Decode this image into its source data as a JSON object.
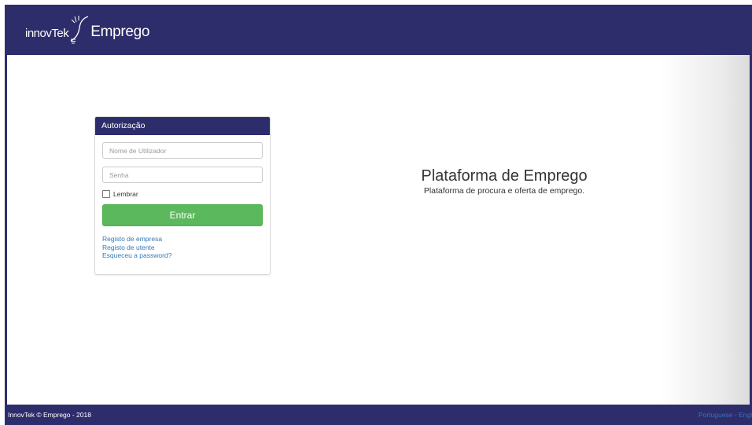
{
  "header": {
    "logo_prefix": "innovTek",
    "logo_name": "Emprego"
  },
  "login": {
    "title": "Autorização",
    "username_placeholder": "Nome de Utilizador",
    "password_placeholder": "Senha",
    "remember_label": "Lembrar",
    "submit_label": "Entrar",
    "links": [
      "Registo de empresa",
      "Registo de utente",
      "Esqueceu a password?"
    ]
  },
  "hero": {
    "title": "Plataforma de Emprego",
    "subtitle": "Plataforma de procura e oferta de emprego."
  },
  "footer": {
    "copyright": "InnovTek © Emprego - 2018",
    "lang_portuguese": "Portuguese",
    "lang_separator": " - ",
    "lang_english": "Engl"
  },
  "colors": {
    "brand": "#2e2d6b",
    "button": "#5cb85c",
    "link": "#337ab7"
  },
  "icons": {
    "logo": "lightbulb-logo-icon"
  }
}
